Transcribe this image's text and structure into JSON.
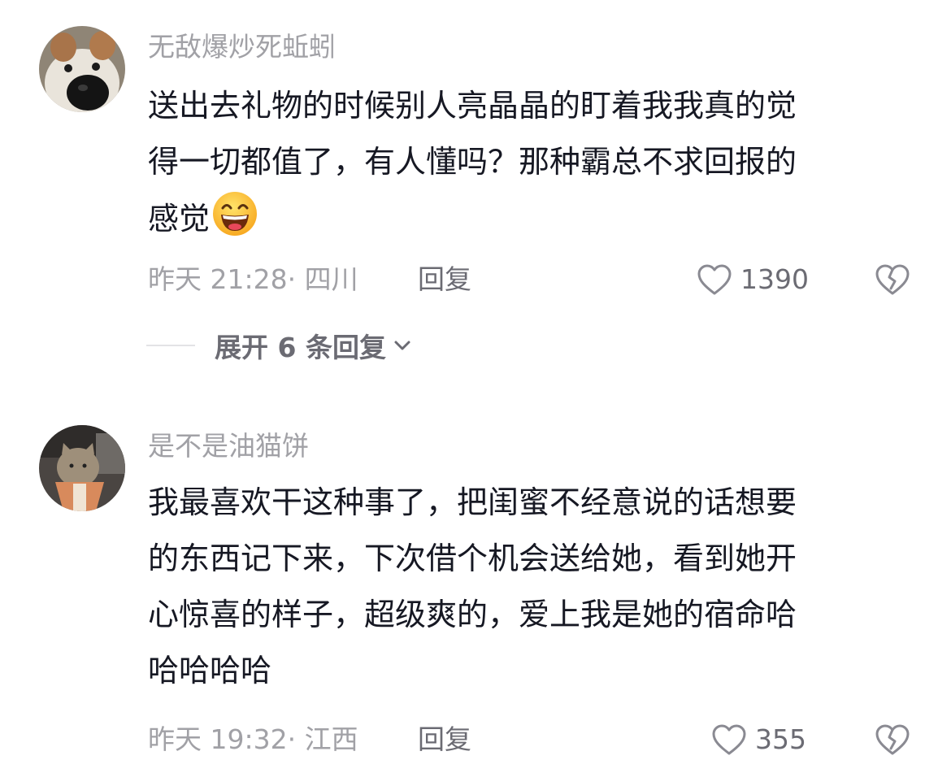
{
  "comments": [
    {
      "username": "无敌爆炒死蚯蚓",
      "avatar_icon": "dog-avatar",
      "lines": [
        "送出去礼物的时候别人亮晶晶的盯着我我真的觉",
        "得一切都值了，有人懂吗？那种霸总不求回报的",
        "感觉"
      ],
      "emoji_icon": "grinning-face-emoji",
      "time_location": "昨天 21:28· 四川",
      "reply_label": "回复",
      "likes": "1390",
      "expand_label": "展开 6 条回复"
    },
    {
      "username": "是不是油猫饼",
      "avatar_icon": "cat-avatar",
      "lines": [
        "我最喜欢干这种事了，把闺蜜不经意说的话想要",
        "的东西记下来，下次借个机会送给她，看到她开",
        "心惊喜的样子，超级爽的，爱上我是她的宿命哈",
        "哈哈哈哈"
      ],
      "time_location": "昨天 19:32· 江西",
      "reply_label": "回复",
      "likes": "355"
    }
  ],
  "colors": {
    "text": "#161823",
    "muted": "#a1a1a6",
    "secondary": "#6b6b73"
  }
}
